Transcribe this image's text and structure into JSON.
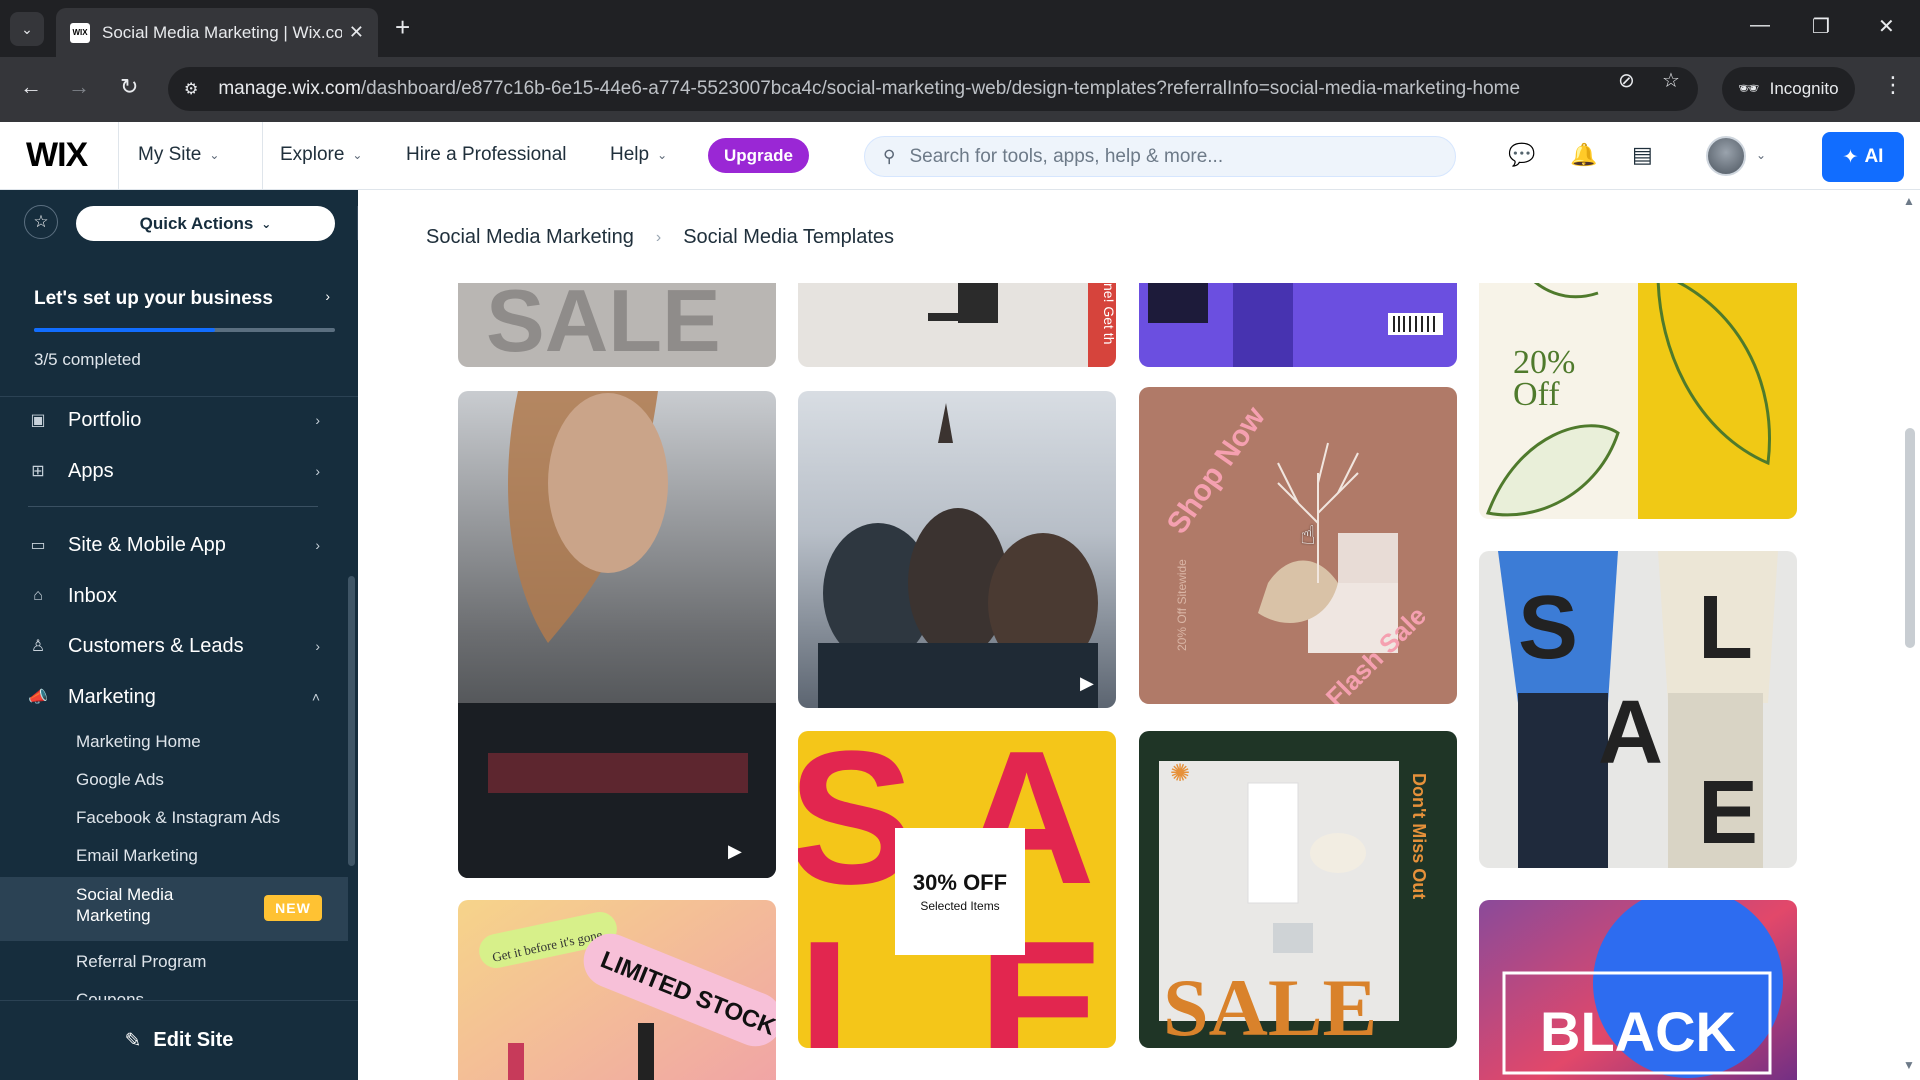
{
  "browser": {
    "tab_title": "Social Media Marketing | Wix.com",
    "favicon_text": "WIX",
    "url_domain": "manage.wix.com",
    "url_path": "/dashboard/e877c16b-6e15-44e6-a774-5523007bca4c/social-marketing-web/design-templates?referralInfo=social-media-marketing-home",
    "incognito_label": "Incognito"
  },
  "wixbar": {
    "logo": "WIX",
    "my_site": "My Site",
    "explore": "Explore",
    "hire": "Hire a Professional",
    "help": "Help",
    "upgrade": "Upgrade",
    "search_placeholder": "Search for tools, apps, help & more...",
    "ai_label": "AI"
  },
  "sidebar": {
    "quick_actions": "Quick Actions",
    "setup_title": "Let's set up your business",
    "setup_count": "3/5 completed",
    "setup_progress": 0.6,
    "items": [
      {
        "label": "Portfolio",
        "icon": "portfolio-icon"
      },
      {
        "label": "Apps",
        "icon": "apps-icon"
      },
      {
        "label": "Site & Mobile App",
        "icon": "site-mobile-icon"
      },
      {
        "label": "Inbox",
        "icon": "inbox-icon"
      },
      {
        "label": "Customers & Leads",
        "icon": "customers-icon"
      },
      {
        "label": "Marketing",
        "icon": "marketing-icon"
      }
    ],
    "marketing_sub": [
      "Marketing Home",
      "Google Ads",
      "Facebook & Instagram Ads",
      "Email Marketing",
      "Social Media Marketing",
      "Referral Program",
      "Coupons"
    ],
    "new_badge": "NEW",
    "edit_site": "Edit Site"
  },
  "breadcrumb": {
    "parent": "Social Media Marketing",
    "current": "Social Media Templates"
  },
  "templates": {
    "sale_text": "SALE",
    "get_it_text": "ne! Get th",
    "pct_20": "20%",
    "off": "Off",
    "shop_now": "Shop Now",
    "sitewide": "20% Off Sitewide",
    "flash_sale": "Flash Sale",
    "pct_30": "30% OFF",
    "selected_items": "Selected Items",
    "dont_miss": "Don't Miss Out",
    "get_before": "Get it before it's gone",
    "limited_stock": "LIMITED STOCK",
    "black": "BLACK",
    "sa_letters": [
      "S",
      "A",
      "L",
      "E"
    ]
  }
}
